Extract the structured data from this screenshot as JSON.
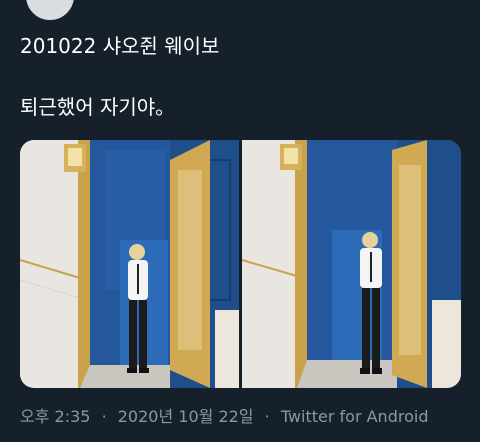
{
  "tweet": {
    "line1": "201022 샤오쥔 웨이보",
    "line2": "퇴근했어 자기야。"
  },
  "media": {
    "photos": [
      {
        "description_icon": "photo-icon"
      },
      {
        "description_icon": "photo-icon"
      }
    ]
  },
  "meta": {
    "time": "오후 2:35",
    "date": "2020년 10월 22일",
    "separator": "·",
    "source": "Twitter for Android"
  },
  "colors": {
    "background": "#15202b",
    "text": "#ffffff",
    "secondary_text": "#8899a6",
    "wall_blue": "#1f4f8a",
    "door_gold": "#c9a24a"
  }
}
